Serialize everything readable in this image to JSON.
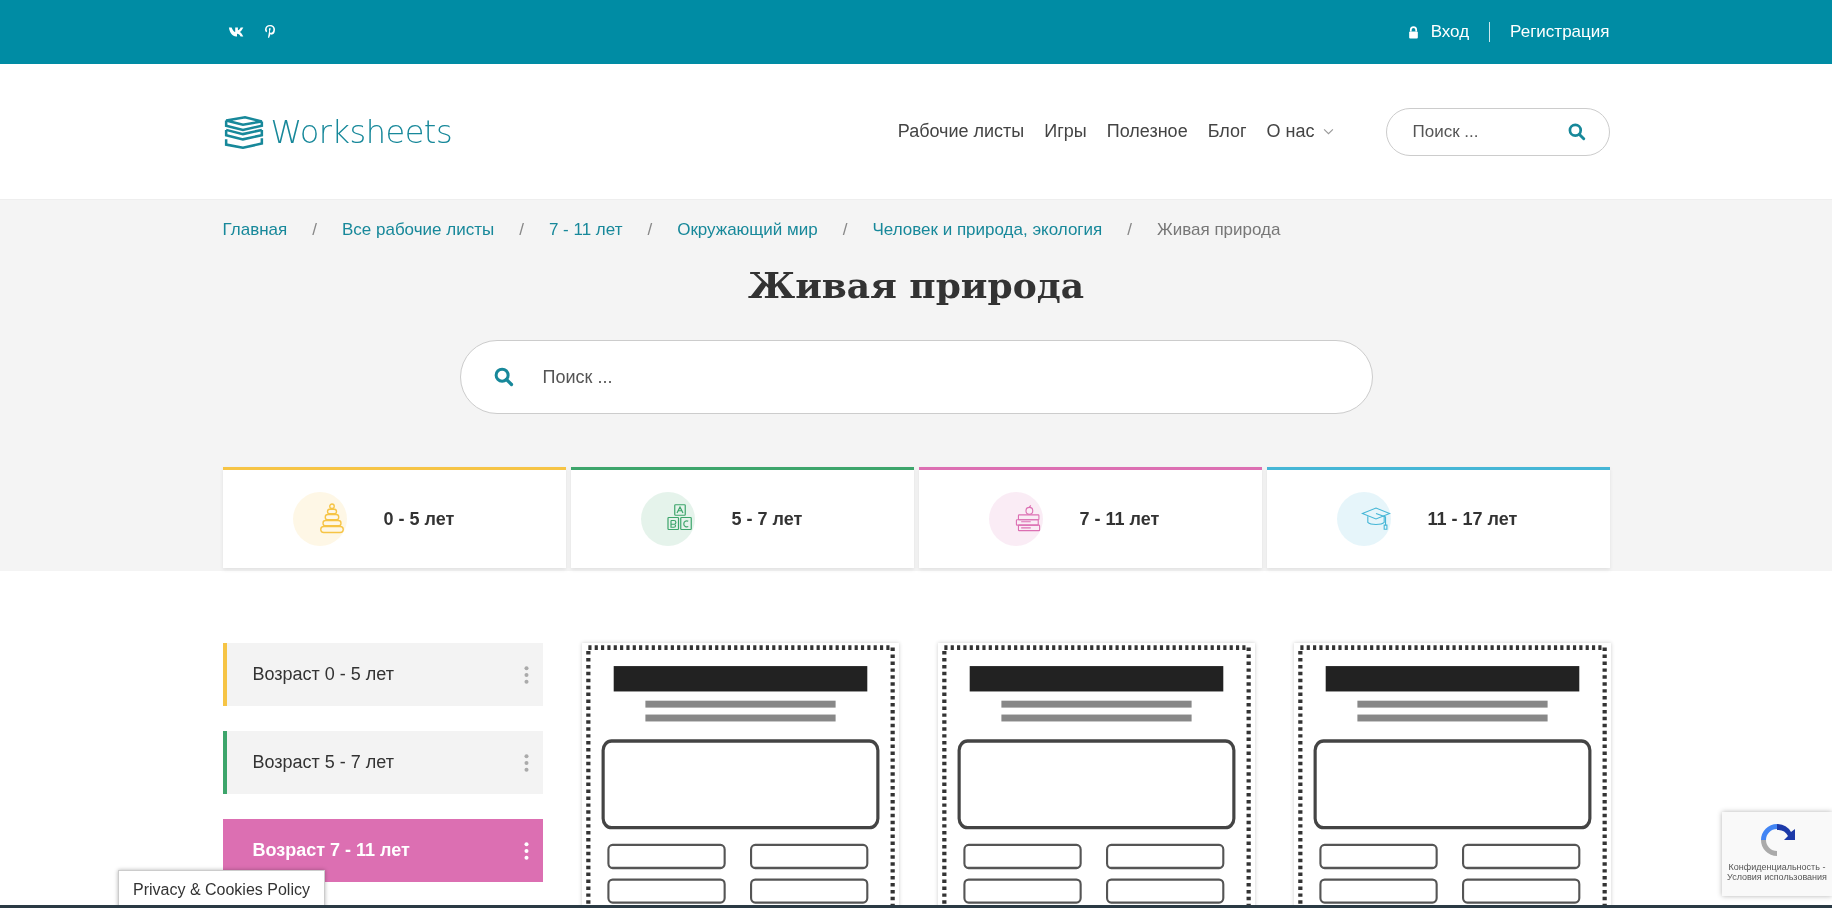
{
  "top_bar": {
    "social": [
      {
        "kind": "vk"
      },
      {
        "kind": "pinterest"
      }
    ],
    "login": "Вход",
    "register": "Регистрация"
  },
  "header": {
    "logo": "Worksheets",
    "nav": [
      {
        "label": "Рабочие листы",
        "dropdown": false
      },
      {
        "label": "Игры",
        "dropdown": false
      },
      {
        "label": "Полезное",
        "dropdown": false
      },
      {
        "label": "Блог",
        "dropdown": false
      },
      {
        "label": "О нас",
        "dropdown": true
      }
    ],
    "search": {
      "placeholder": "Поиск ..."
    }
  },
  "breadcrumbs": [
    {
      "label": "Главная",
      "current": false
    },
    {
      "separator": "/",
      "label": "Все рабочие листы",
      "current": false
    },
    {
      "separator": "/",
      "label": "7 - 11 лет",
      "current": false
    },
    {
      "separator": "/",
      "label": "Окружающий мир",
      "current": false
    },
    {
      "separator": "/",
      "label": "Человек и природа, экология",
      "current": false
    },
    {
      "separator": "/",
      "label": "Живая природа",
      "current": true
    }
  ],
  "title": "Живая природа",
  "search": {
    "placeholder": "Поиск ..."
  },
  "age_cards": [
    {
      "label": "0 - 5 лет",
      "color": "#f6c445",
      "kind": "pyramid"
    },
    {
      "label": "5 - 7 лет",
      "color": "#3da56b",
      "kind": "blocks"
    },
    {
      "label": "7 - 11 лет",
      "color": "#dc6fb2",
      "kind": "books"
    },
    {
      "label": "11 - 17 лет",
      "color": "#45b6d6",
      "kind": "cap"
    }
  ],
  "sidebar": [
    {
      "label": "Возраст 0 - 5 лет",
      "color": "#f6c445",
      "selected": false
    },
    {
      "label": "Возраст 5 - 7 лет",
      "color": "#3da56b",
      "selected": false
    },
    {
      "label": "Возраст 7 - 11 лет",
      "color": "#dc6fb2",
      "selected": true
    }
  ],
  "worksheets": [
    {
      "kind": "worksheet"
    },
    {
      "kind": "worksheet"
    },
    {
      "kind": "worksheet"
    }
  ],
  "cookie_button": "Privacy & Cookies Policy",
  "recaptcha": {
    "text": "Конфиденциальность - Условия использования"
  }
}
